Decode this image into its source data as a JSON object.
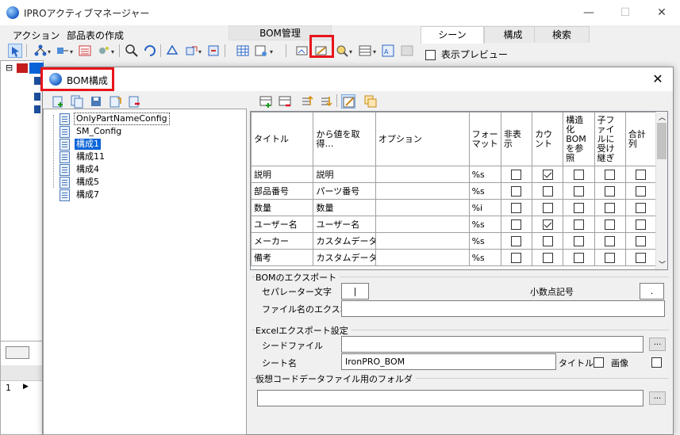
{
  "window": {
    "title": "IPROアクティブマネージャー",
    "minimize": "—",
    "maximize": "☐",
    "close": "✕"
  },
  "menu": {
    "items": [
      "アクション",
      "部品表の作成"
    ],
    "bom_tab": "BOM管理"
  },
  "right_panel": {
    "tabs": [
      "シーン",
      "構成",
      "検索"
    ],
    "preview_label": "表示プレビュー"
  },
  "bg_tree": {
    "root_prefix": "⊟"
  },
  "bg_bottom": {
    "row_number": "1",
    "row_pointer": "▶"
  },
  "dialog": {
    "title": "BOM構成",
    "close": "✕",
    "configs": [
      {
        "label": "OnlyPartNameConfig",
        "selected": false,
        "focused": true
      },
      {
        "label": "SM_Config",
        "selected": false,
        "focused": false
      },
      {
        "label": "構成1",
        "selected": true,
        "focused": false
      },
      {
        "label": "構成11",
        "selected": false,
        "focused": false
      },
      {
        "label": "構成4",
        "selected": false,
        "focused": false
      },
      {
        "label": "構成5",
        "selected": false,
        "focused": false
      },
      {
        "label": "構成7",
        "selected": false,
        "focused": false
      }
    ],
    "grid": {
      "headers": [
        "タイトル",
        "から値を取得…",
        "オプション",
        "フォーマット",
        "非表示",
        "カウント",
        "構造化BOMを参照",
        "子ファイルに受け継ぎ",
        "合計列"
      ],
      "rows": [
        {
          "title": "説明",
          "source": "説明",
          "option": "",
          "format": "%s",
          "hidden": false,
          "count": true,
          "structured": false,
          "inherit": false,
          "total": false
        },
        {
          "title": "部品番号",
          "source": "パーツ番号",
          "option": "",
          "format": "%s",
          "hidden": false,
          "count": false,
          "structured": false,
          "inherit": false,
          "total": false
        },
        {
          "title": "数量",
          "source": "数量",
          "option": "",
          "format": "%i",
          "hidden": false,
          "count": false,
          "structured": false,
          "inherit": false,
          "total": false
        },
        {
          "title": "ユーザー名",
          "source": "ユーザー名",
          "option": "",
          "format": "%s",
          "hidden": false,
          "count": true,
          "structured": false,
          "inherit": false,
          "total": false
        },
        {
          "title": "メーカー",
          "source": "カスタムデータ…",
          "option": "",
          "format": "%s",
          "hidden": false,
          "count": false,
          "structured": false,
          "inherit": false,
          "total": false
        },
        {
          "title": "備考",
          "source": "カスタムデータ…",
          "option": "",
          "format": "%s",
          "hidden": false,
          "count": false,
          "structured": false,
          "inherit": false,
          "total": false
        }
      ]
    },
    "bom_export": {
      "group_title": "BOMのエクスポート",
      "separator_label": "セパレーター文字",
      "separator_value": "|",
      "decimal_label": "小数点記号",
      "decimal_value": ".",
      "filename_label": "ファイル名のエクスポート",
      "filename_value": ""
    },
    "excel_export": {
      "group_title": "Excelエクスポート設定",
      "seed_file_label": "シードファイル",
      "seed_file_value": "",
      "sheet_label": "シート名",
      "sheet_value": "IronPRO_BOM",
      "title_label": "タイトル",
      "title_checked": false,
      "image_label": "画像",
      "image_checked": false,
      "browse": "..."
    },
    "virtual_folder": {
      "group_title": "仮想コードデータファイル用のフォルダ",
      "value": "",
      "browse": "..."
    }
  }
}
